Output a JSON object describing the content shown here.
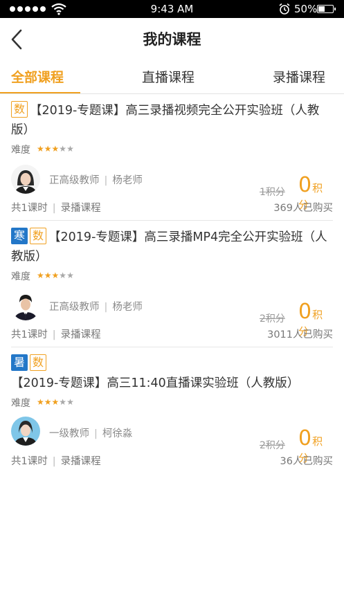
{
  "status_bar": {
    "time": "9:43 AM",
    "battery": "50%"
  },
  "nav": {
    "title": "我的课程",
    "back_icon": "chevron-left-icon"
  },
  "tabs": [
    {
      "label": "全部课程",
      "active": true
    },
    {
      "label": "直播课程",
      "active": false
    },
    {
      "label": "录播课程",
      "active": false
    }
  ],
  "colors": {
    "accent": "#f0a020",
    "tag_blue": "#2377c8"
  },
  "difficulty_label": "难度",
  "courses": [
    {
      "tags": [
        "数"
      ],
      "season_tag": "",
      "title": "【2019-专题课】高三录播视频完全公开实验班（人教版）",
      "difficulty_stars": 3,
      "difficulty_max": 5,
      "teacher_level": "正高级教师",
      "teacher_name": "杨老师",
      "lessons": "共1课时",
      "type": "录播课程",
      "original_price": "1积分",
      "price_num": "0",
      "price_unit": "积分",
      "buyers": "369人已购买"
    },
    {
      "tags": [
        "数"
      ],
      "season_tag": "寒",
      "title": "【2019-专题课】高三录播MP4完全公开实验班（人教版）",
      "difficulty_stars": 3,
      "difficulty_max": 5,
      "teacher_level": "正高级教师",
      "teacher_name": "杨老师",
      "lessons": "共1课时",
      "type": "录播课程",
      "original_price": "2积分",
      "price_num": "0",
      "price_unit": "积分",
      "buyers": "3011人已购买"
    },
    {
      "tags": [
        "数"
      ],
      "season_tag": "暑",
      "title": "【2019-专题课】高三11:40直播课实验班（人教版）",
      "difficulty_stars": 3,
      "difficulty_max": 5,
      "teacher_level": "一级教师",
      "teacher_name": "柯徐淼",
      "lessons": "共1课时",
      "type": "录播课程",
      "original_price": "2积分",
      "price_num": "0",
      "price_unit": "积分",
      "buyers": "36人已购买"
    }
  ]
}
